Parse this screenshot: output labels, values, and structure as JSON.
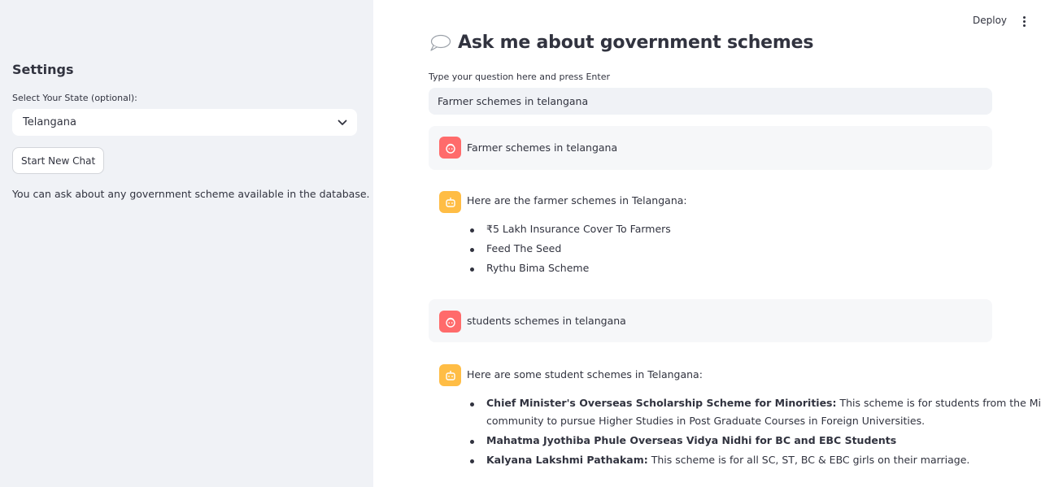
{
  "sidebar": {
    "title": "Settings",
    "state_label": "Select Your State (optional):",
    "state_selected": "Telangana",
    "new_chat_label": "Start New Chat",
    "help_text": "You can ask about any government scheme available in the database."
  },
  "toolbar": {
    "deploy_label": "Deploy",
    "more_icon": "vertical-ellipsis-icon"
  },
  "main": {
    "title_icon": "speech-bubble-icon",
    "title": "Ask me about government schemes",
    "input_label": "Type your question here and press Enter",
    "input_value": "Farmer schemes in telangana"
  },
  "chat": {
    "m1": {
      "role": "user",
      "avatar": "user-face-icon",
      "text": "Farmer schemes in telangana"
    },
    "m2": {
      "role": "assistant",
      "avatar": "robot-icon",
      "text": "Here are the farmer schemes in Telangana:",
      "items": [
        "₹5 Lakh Insurance Cover To Farmers",
        "Feed The Seed",
        "Rythu Bima Scheme"
      ]
    },
    "m3": {
      "role": "user",
      "avatar": "user-face-icon",
      "text": "students schemes in telangana"
    },
    "m4": {
      "role": "assistant",
      "avatar": "robot-icon",
      "text": "Here are some student schemes in Telangana:",
      "items": [
        {
          "bold": "Chief Minister's Overseas Scholarship Scheme for Minorities:",
          "rest": " This scheme is for students from the Minority",
          "cont": "community to pursue Higher Studies in Post Graduate Courses in Foreign Universities."
        },
        {
          "bold": "Mahatma Jyothiba Phule Overseas Vidya Nidhi for BC and EBC Students",
          "rest": ""
        },
        {
          "bold": "Kalyana Lakshmi Pathakam:",
          "rest": " This scheme is for all SC, ST, BC & EBC girls on their marriage."
        }
      ]
    }
  }
}
